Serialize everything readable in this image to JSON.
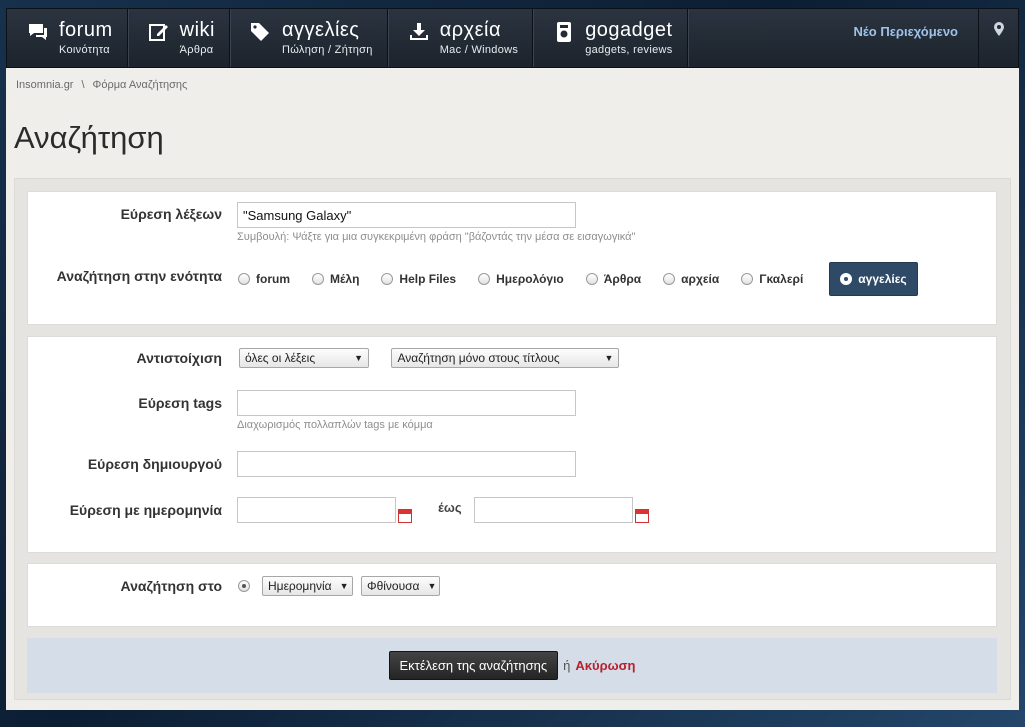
{
  "nav": {
    "items": [
      {
        "title": "forum",
        "sub": "Κοινότητα",
        "icon": "chat-bubble-icon"
      },
      {
        "title": "wiki",
        "sub": "Άρθρα",
        "icon": "edit-icon"
      },
      {
        "title": "αγγελίες",
        "sub": "Πώληση / Ζήτηση",
        "icon": "tag-icon"
      },
      {
        "title": "αρχεία",
        "sub": "Mac / Windows",
        "icon": "download-icon"
      },
      {
        "title": "gogadget",
        "sub": "gadgets, reviews",
        "icon": "device-icon"
      }
    ],
    "new_content": "Νέο Περιεχόμενο"
  },
  "breadcrumb": {
    "home": "Insomnia.gr",
    "separator": "\\",
    "current": "Φόρμα Αναζήτησης"
  },
  "page_title": "Αναζήτηση",
  "search": {
    "find_words_label": "Εύρεση λέξεων",
    "find_words_value": "\"Samsung Galaxy\"",
    "find_words_hint": "Συμβουλή: Ψάξτε για μια συγκεκριμένη φράση \"βάζοντάς την μέσα σε εισαγωγικά\"",
    "section_label": "Αναζήτηση στην ενότητα",
    "sections": [
      {
        "label": "forum",
        "selected": false
      },
      {
        "label": "Μέλη",
        "selected": false
      },
      {
        "label": "Help Files",
        "selected": false
      },
      {
        "label": "Ημερολόγιο",
        "selected": false
      },
      {
        "label": "Άρθρα",
        "selected": false
      },
      {
        "label": "αρχεία",
        "selected": false
      },
      {
        "label": "Γκαλερί",
        "selected": false
      },
      {
        "label": "αγγελίες",
        "selected": true
      }
    ]
  },
  "match": {
    "label": "Αντιστοίχιση",
    "words_select": "όλες οι λέξεις",
    "scope_select": "Αναζήτηση μόνο στους τίτλους"
  },
  "tags": {
    "label": "Εύρεση tags",
    "value": "",
    "hint": "Διαχωρισμός πολλαπλών tags με κόμμα"
  },
  "author": {
    "label": "Εύρεση δημιουργού",
    "value": ""
  },
  "dates": {
    "label": "Εύρεση με ημερομηνία",
    "until": "έως",
    "from_value": "",
    "to_value": ""
  },
  "sort": {
    "label": "Αναζήτηση στο",
    "field_select": "Ημερομηνία",
    "order_select": "Φθίνουσα"
  },
  "actions": {
    "submit": "Εκτέλεση της αναζήτησης",
    "or": "ή",
    "cancel": "Ακύρωση"
  },
  "colors": {
    "accent": "#2f4a67",
    "cancel": "#b8202e",
    "footer": "#d5dde8"
  }
}
